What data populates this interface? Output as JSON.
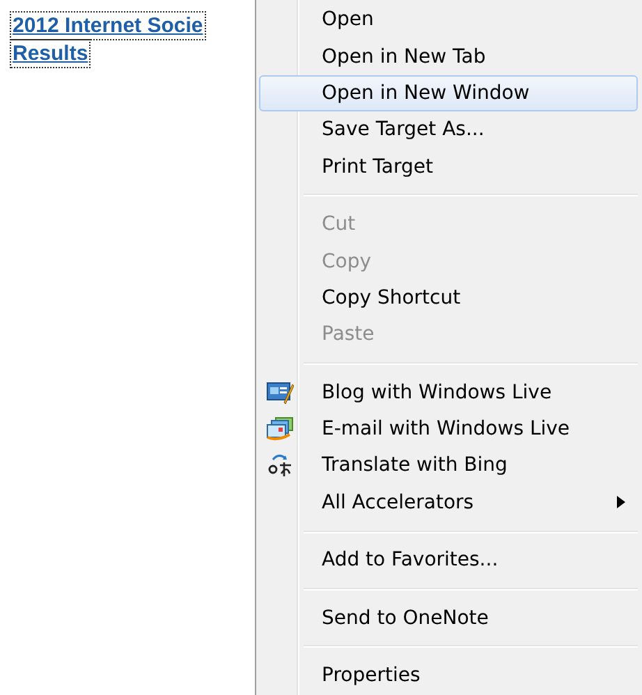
{
  "link": {
    "lines": [
      "2012 Internet Socie",
      "Results"
    ],
    "focused": true
  },
  "menu": {
    "items": [
      {
        "kind": "plain",
        "label": "Open",
        "disabled": false,
        "selected": false
      },
      {
        "kind": "plain",
        "label": "Open in New Tab",
        "disabled": false,
        "selected": false
      },
      {
        "kind": "plain",
        "label": "Open in New Window",
        "disabled": false,
        "selected": true
      },
      {
        "kind": "plain",
        "label": "Save Target As...",
        "disabled": false,
        "selected": false
      },
      {
        "kind": "plain",
        "label": "Print Target",
        "disabled": false,
        "selected": false
      },
      {
        "kind": "separator"
      },
      {
        "kind": "plain",
        "label": "Cut",
        "disabled": true,
        "selected": false
      },
      {
        "kind": "plain",
        "label": "Copy",
        "disabled": true,
        "selected": false
      },
      {
        "kind": "plain",
        "label": "Copy Shortcut",
        "disabled": false,
        "selected": false
      },
      {
        "kind": "plain",
        "label": "Paste",
        "disabled": true,
        "selected": false
      },
      {
        "kind": "separator"
      },
      {
        "kind": "blog",
        "label": "Blog with Windows Live",
        "disabled": false,
        "selected": false
      },
      {
        "kind": "email",
        "label": "E-mail with Windows Live",
        "disabled": false,
        "selected": false
      },
      {
        "kind": "translate",
        "label": "Translate with Bing",
        "disabled": false,
        "selected": false
      },
      {
        "kind": "submenu",
        "label": "All Accelerators",
        "disabled": false,
        "selected": false
      },
      {
        "kind": "separator"
      },
      {
        "kind": "plain",
        "label": "Add to Favorites...",
        "disabled": false,
        "selected": false
      },
      {
        "kind": "separator"
      },
      {
        "kind": "plain",
        "label": "Send to OneNote",
        "disabled": false,
        "selected": false
      },
      {
        "kind": "separator"
      },
      {
        "kind": "plain",
        "label": "Properties",
        "disabled": false,
        "selected": false
      }
    ]
  }
}
